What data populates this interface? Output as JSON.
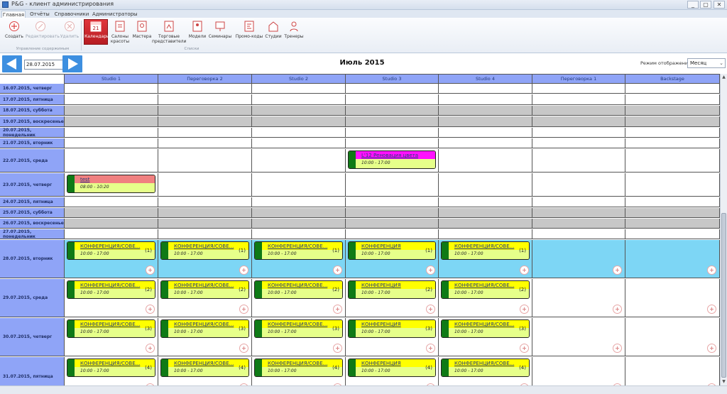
{
  "window": {
    "title": "P&G - клиент администрирования",
    "buttons": [
      "_",
      "▢",
      "✕"
    ]
  },
  "ribbon": {
    "tabs": [
      {
        "label": "Главная",
        "active": true
      },
      {
        "label": "Отчёты",
        "active": false
      },
      {
        "label": "Справочники",
        "active": false
      },
      {
        "label": "Администраторы",
        "active": false
      }
    ],
    "manage_buttons": [
      {
        "label": "Создать",
        "icon": "create-icon",
        "disabled": false
      },
      {
        "label": "Редактировать",
        "icon": "edit-icon",
        "disabled": true
      },
      {
        "label": "Удалить",
        "icon": "delete-icon",
        "disabled": true
      }
    ],
    "manage_group_label": "Управление содержимым",
    "list_buttons": [
      {
        "label": "Календарь",
        "icon": "calendar-icon",
        "active": true,
        "badge": "21"
      },
      {
        "label": "Салоны красоты",
        "icon": "salon-icon",
        "active": false
      },
      {
        "label": "Мастера",
        "icon": "master-icon",
        "active": false
      },
      {
        "label": "Торговые представители",
        "icon": "sales-rep-icon",
        "active": false
      },
      {
        "label": "Модели",
        "icon": "model-icon",
        "active": false
      },
      {
        "label": "Семинары",
        "icon": "seminar-icon",
        "active": false
      },
      {
        "label": "Промо-коды",
        "icon": "promo-icon",
        "active": false
      },
      {
        "label": "Студии",
        "icon": "studio-icon",
        "active": false
      },
      {
        "label": "Тренеры",
        "icon": "trainer-icon",
        "active": false
      }
    ],
    "list_group_label": "Списки"
  },
  "nav": {
    "date_value": "28.07.2015",
    "date_icon_text": "15",
    "month_title": "Июль 2015",
    "mode_label": "Режим отображения",
    "mode_value": "Месяц"
  },
  "columns": [
    "Studio 1",
    "Переговорка 2",
    "Studio 2",
    "Studio 3",
    "Studio 4",
    "Переговорка 1",
    "Backstage"
  ],
  "rows": [
    {
      "label": "16.07.2015, четверг",
      "type": "normal",
      "h": 14
    },
    {
      "label": "17.07.2015, пятница",
      "type": "normal",
      "h": 15
    },
    {
      "label": "18.07.2015, суббота",
      "type": "weekend",
      "h": 14
    },
    {
      "label": "19.07.2015, воскресенье",
      "type": "weekend",
      "h": 15
    },
    {
      "label": "20.07.2015, понедельник",
      "type": "normal",
      "h": 14
    },
    {
      "label": "21.07.2015, вторник",
      "type": "normal",
      "h": 14
    },
    {
      "label": "22.07.2015, среда",
      "type": "normal",
      "h": 33
    },
    {
      "label": "23.07.2015, четверг",
      "type": "normal",
      "h": 33
    },
    {
      "label": "24.07.2015, пятница",
      "type": "normal",
      "h": 14
    },
    {
      "label": "25.07.2015, суббота",
      "type": "weekend",
      "h": 14
    },
    {
      "label": "26.07.2015, воскресенье",
      "type": "weekend",
      "h": 14
    },
    {
      "label": "27.07.2015, понедельник",
      "type": "normal",
      "h": 14
    },
    {
      "label": "28.07.2015, вторник",
      "type": "today",
      "h": 54
    },
    {
      "label": "29.07.2015, среда",
      "type": "normal",
      "h": 54
    },
    {
      "label": "30.07.2015, четверг",
      "type": "normal",
      "h": 54
    },
    {
      "label": "31.07.2015, пятница",
      "type": "normal",
      "h": 55
    }
  ],
  "events": [
    {
      "row": 6,
      "col": 3,
      "title": "L'12 Реновация цвета",
      "time": "10:00 - 17:00",
      "count": "",
      "color": "#ff11ff"
    },
    {
      "row": 7,
      "col": 0,
      "title": "test",
      "time": "08:00 - 10:20",
      "count": "",
      "color": "#f08080"
    },
    {
      "row": 12,
      "col": 0,
      "title": "КОНФЕРЕНЦИЯ/СОВЕ...",
      "time": "10:00 - 17:00",
      "count": "(1)",
      "color": "#ffff00"
    },
    {
      "row": 12,
      "col": 1,
      "title": "КОНФЕРЕНЦИЯ/СОВЕ...",
      "time": "10:00 - 17:00",
      "count": "(1)",
      "color": "#ffff00"
    },
    {
      "row": 12,
      "col": 2,
      "title": "КОНФЕРЕНЦИЯ/СОВЕ...",
      "time": "10:00 - 17:00",
      "count": "(1)",
      "color": "#ffff00"
    },
    {
      "row": 12,
      "col": 3,
      "title": "КОНФЕРЕНЦИЯ",
      "time": "10:00 - 17:00",
      "count": "(1)",
      "color": "#ffff00"
    },
    {
      "row": 12,
      "col": 4,
      "title": "КОНФЕРЕНЦИЯ/СОВЕ...",
      "time": "10:00 - 17:00",
      "count": "(1)",
      "color": "#ffff00"
    },
    {
      "row": 13,
      "col": 0,
      "title": "КОНФЕРЕНЦИЯ/СОВЕ...",
      "time": "10:00 - 17:00",
      "count": "(2)",
      "color": "#ffff00"
    },
    {
      "row": 13,
      "col": 1,
      "title": "КОНФЕРЕНЦИЯ/СОВЕ...",
      "time": "10:00 - 17:00",
      "count": "(2)",
      "color": "#ffff00"
    },
    {
      "row": 13,
      "col": 2,
      "title": "КОНФЕРЕНЦИЯ/СОВЕ...",
      "time": "10:00 - 17:00",
      "count": "(2)",
      "color": "#ffff00"
    },
    {
      "row": 13,
      "col": 3,
      "title": "КОНФЕРЕНЦИЯ",
      "time": "10:00 - 17:00",
      "count": "(2)",
      "color": "#ffff00"
    },
    {
      "row": 13,
      "col": 4,
      "title": "КОНФЕРЕНЦИЯ/СОВЕ...",
      "time": "10:00 - 17:00",
      "count": "(2)",
      "color": "#ffff00"
    },
    {
      "row": 14,
      "col": 0,
      "title": "КОНФЕРЕНЦИЯ/СОВЕ...",
      "time": "10:00 - 17:00",
      "count": "(3)",
      "color": "#ffff00"
    },
    {
      "row": 14,
      "col": 1,
      "title": "КОНФЕРЕНЦИЯ/СОВЕ...",
      "time": "10:00 - 17:00",
      "count": "(3)",
      "color": "#ffff00"
    },
    {
      "row": 14,
      "col": 2,
      "title": "КОНФЕРЕНЦИЯ/СОВЕ...",
      "time": "10:00 - 17:00",
      "count": "(3)",
      "color": "#ffff00"
    },
    {
      "row": 14,
      "col": 3,
      "title": "КОНФЕРЕНЦИЯ",
      "time": "10:00 - 17:00",
      "count": "(3)",
      "color": "#ffff00"
    },
    {
      "row": 14,
      "col": 4,
      "title": "КОНФЕРЕНЦИЯ/СОВЕ...",
      "time": "10:00 - 17:00",
      "count": "(3)",
      "color": "#ffff00"
    },
    {
      "row": 15,
      "col": 0,
      "title": "КОНФЕРЕНЦИЯ/СОВЕ...",
      "time": "10:00 - 17:00",
      "count": "(4)",
      "color": "#ffff00"
    },
    {
      "row": 15,
      "col": 1,
      "title": "КОНФЕРЕНЦИЯ/СОВЕ...",
      "time": "10:00 - 17:00",
      "count": "(4)",
      "color": "#ffff00"
    },
    {
      "row": 15,
      "col": 2,
      "title": "КОНФЕРЕНЦИЯ/СОВЕ...",
      "time": "10:00 - 17:00",
      "count": "(4)",
      "color": "#ffff00"
    },
    {
      "row": 15,
      "col": 3,
      "title": "КОНФЕРЕНЦИЯ",
      "time": "10:00 - 17:00",
      "count": "(4)",
      "color": "#ffff00"
    },
    {
      "row": 15,
      "col": 4,
      "title": "КОНФЕРЕНЦИЯ/СОВЕ...",
      "time": "10:00 - 17:00",
      "count": "(4)",
      "color": "#ffff00"
    }
  ],
  "colors": {
    "accent": "#8fa4f7",
    "today_row": "#7dd6f5",
    "weekend_row": "#c7c7c7",
    "event_bar": "#0f7a16",
    "active_ribbon": "#d42a30",
    "nav_arrow": "#3d8fe0"
  }
}
